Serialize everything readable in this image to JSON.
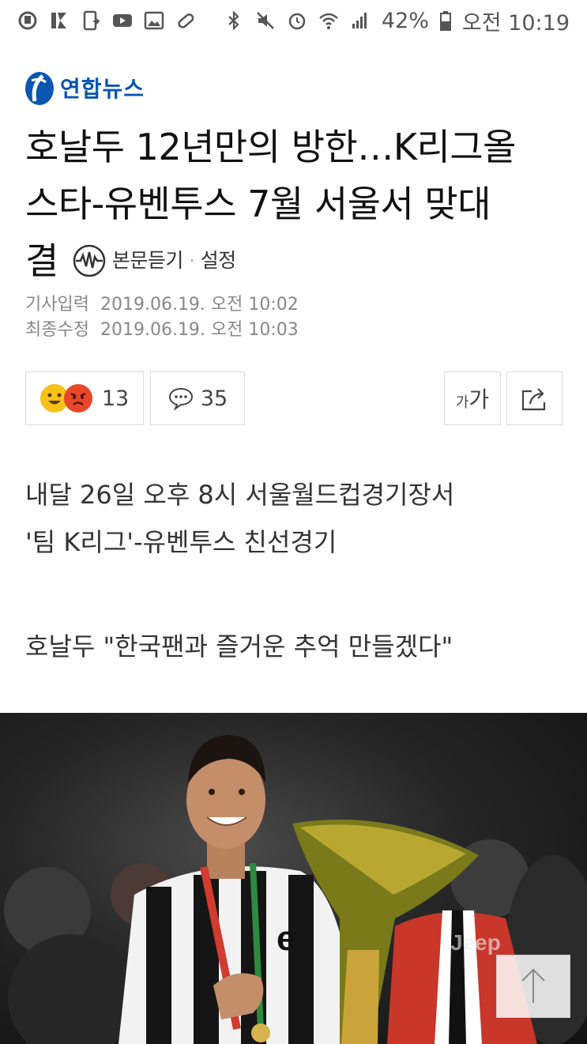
{
  "status_bar": {
    "battery": "42%",
    "time": "오전 10:19"
  },
  "logo": {
    "text": "연합뉴스"
  },
  "headline": {
    "line1": "호날두 12년만의 방한…K리그올",
    "line2": "스타-유벤투스 7월 서울서 맞대",
    "line3": "결",
    "tts_label": "본문듣기",
    "tts_separator": "·",
    "tts_settings": "설정"
  },
  "dates": {
    "published_label": "기사입력",
    "published_value": "2019.06.19. 오전 10:02",
    "modified_label": "최종수정",
    "modified_value": "2019.06.19. 오전 10:03"
  },
  "actions": {
    "reaction_count": "13",
    "comment_count": "35",
    "font_size_small": "가",
    "font_size_large": "가"
  },
  "summary": {
    "line1": "내달 26일 오후 8시 서울월드컵경기장서",
    "line2": "'팀 K리그'-유벤투스 친선경기",
    "line3": "호날두 \"한국팬과 즐거운 추억 만들겠다\""
  },
  "photo": {
    "jersey_text": "Jeep",
    "accent": "#0a56b0"
  }
}
